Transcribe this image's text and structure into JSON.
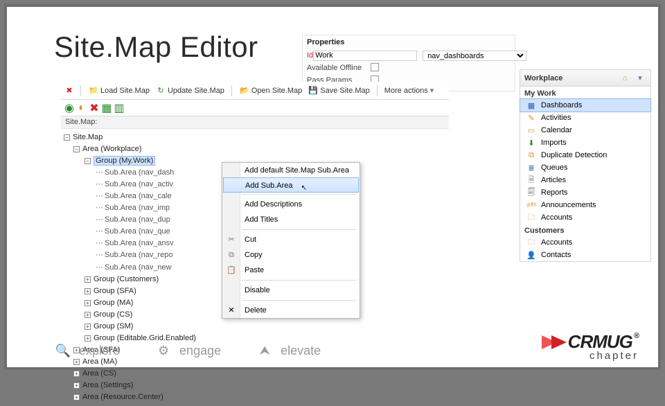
{
  "title": "Site.Map Editor",
  "toolbar": {
    "load": "Load Site.Map",
    "update": "Update Site.Map",
    "open": "Open Site.Map",
    "save": "Save Site.Map",
    "more": "More actions"
  },
  "crumb": "Site.Map:",
  "tree": {
    "root": "Site.Map",
    "area_workplace": "Area (Workplace)",
    "group_mywork": "Group (My.Work)",
    "sub1": "Sub.Area (nav_dash",
    "sub2": "Sub.Area (nav_activ",
    "sub3": "Sub.Area (nav_cale",
    "sub4": "Sub.Area (nav_imp",
    "sub5": "Sub.Area (nav_dup",
    "sub6": "Sub.Area (nav_que",
    "sub7": "Sub.Area (nav_ansv",
    "sub8": "Sub.Area (nav_repo",
    "sub9": "Sub.Area (nav_new",
    "group_customers": "Group (Customers)",
    "group_sfa": "Group (SFA)",
    "group_ma": "Group (MA)",
    "group_cs": "Group (CS)",
    "group_sm": "Group (SM)",
    "group_editable": "Group (Editable.Grid.Enabled)",
    "area_sfa": "Area (SFA)",
    "area_ma": "Area (MA)",
    "area_cs": "Area (CS)",
    "area_settings": "Area (Settings)",
    "area_rc": "Area (Resource.Center)"
  },
  "ctx": {
    "add_default": "Add default Site.Map Sub.Area",
    "add_subarea": "Add Sub.Area",
    "add_desc": "Add Descriptions",
    "add_titles": "Add Titles",
    "cut": "Cut",
    "copy": "Copy",
    "paste": "Paste",
    "disable": "Disable",
    "delete": "Delete"
  },
  "props": {
    "header": "Properties",
    "id_label": "Id",
    "id_value": "Work",
    "offline_label": "Available Offline",
    "pass_label": "Pass Params",
    "select_value": "nav_dashboards"
  },
  "nav": {
    "title": "Workplace",
    "sec1": "My Work",
    "items1": [
      "Dashboards",
      "Activities",
      "Calendar",
      "Imports",
      "Duplicate Detection",
      "Queues",
      "Articles",
      "Reports",
      "Announcements",
      "Accounts"
    ],
    "sec2": "Customers",
    "items2": [
      "Accounts",
      "Contacts"
    ]
  },
  "footer": {
    "a": "explore",
    "b": "engage",
    "c": "elevate"
  },
  "logo": {
    "brand": "CRMUG",
    "sub": "chapter",
    "reg": "®"
  }
}
